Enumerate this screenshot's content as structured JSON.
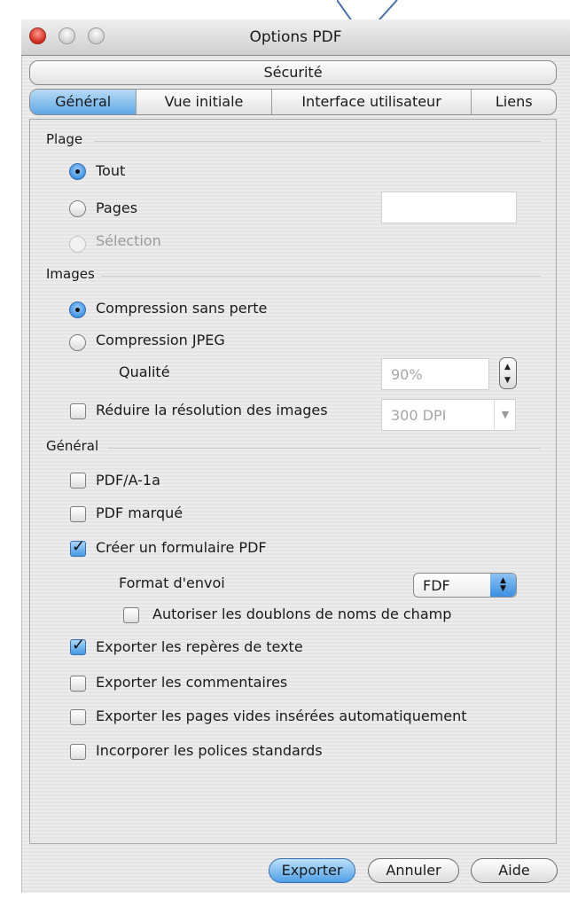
{
  "window": {
    "title": "Options PDF"
  },
  "tabs": {
    "row1": [
      "Sécurité"
    ],
    "row2": [
      "Général",
      "Vue initiale",
      "Interface utilisateur",
      "Liens"
    ],
    "active": "Général"
  },
  "range": {
    "heading": "Plage",
    "all_label": "Tout",
    "pages_label": "Pages",
    "pages_value": "",
    "selection_label": "Sélection",
    "selected": "Tout"
  },
  "images": {
    "heading": "Images",
    "lossless_label": "Compression sans perte",
    "jpeg_label": "Compression JPEG",
    "quality_label": "Qualité",
    "quality_value": "90%",
    "reduce_label": "Réduire la résolution des images",
    "reduce_value": "300 DPI",
    "selected": "Compression sans perte"
  },
  "general": {
    "heading": "Général",
    "pdfa_label": "PDF/A-1a",
    "tagged_label": "PDF marqué",
    "form_label": "Créer un formulaire PDF",
    "submit_format_label": "Format d'envoi",
    "submit_format_value": "FDF",
    "allow_duplicates_label": "Autoriser les doublons de noms de champ",
    "bookmarks_label": "Exporter les repères de texte",
    "comments_label": "Exporter les commentaires",
    "blank_pages_label": "Exporter les pages vides insérées automatiquement",
    "standard_fonts_label": "Incorporer les polices standards",
    "checked": {
      "pdfa": false,
      "tagged": false,
      "form": true,
      "allow_duplicates": false,
      "bookmarks": true,
      "comments": false,
      "blank_pages": false,
      "standard_fonts": false
    }
  },
  "buttons": {
    "export": "Exporter",
    "cancel": "Annuler",
    "help": "Aide"
  },
  "colors": {
    "accent": "#4f9fe6",
    "close": "#d0281c"
  },
  "icons": {
    "pointer": "chevron-down-icon",
    "checkmark": "checkmark-icon"
  }
}
